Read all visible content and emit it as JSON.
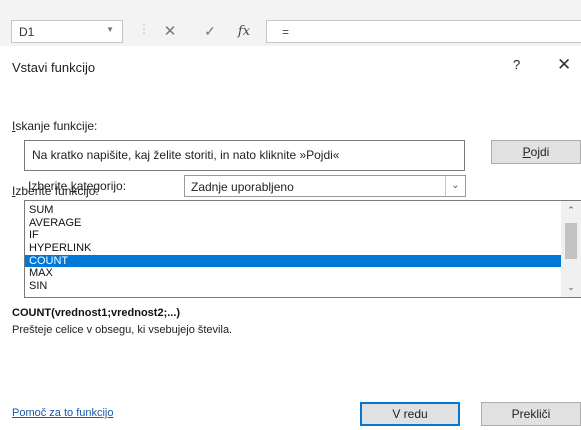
{
  "formula_bar": {
    "namebox": "D1",
    "namebox_arrow": "▼",
    "separator": "⋮",
    "cancel_icon": "✕",
    "enter_icon": "✓",
    "fx_icon": "fx",
    "formula": "="
  },
  "dialog": {
    "title": "Vstavi funkcijo",
    "help": "?",
    "close": "✕",
    "search_label_access": "I",
    "search_label_rest": "skanje funkcije:",
    "search_text": "Na kratko napišite, kaj želite storiti, in nato kliknite »Pojdi«",
    "go_access": "P",
    "go_rest": "ojdi",
    "category_label_pre": "Izberite ",
    "category_label_access": "k",
    "category_label_post": "ategorijo:",
    "category_value": "Zadnje uporabljeno",
    "function_label_access": "I",
    "function_label_rest": "zberite funkcijo:",
    "functions": [
      "SUM",
      "AVERAGE",
      "IF",
      "HYPERLINK",
      "COUNT",
      "MAX",
      "SIN"
    ],
    "selected_index": 4,
    "signature": "COUNT(vrednost1;vrednost2;...)",
    "description": "Prešteje celice v obsegu, ki vsebujejo števila.",
    "help_link": "Pomoč za to funkcijo",
    "ok_label": "V redu",
    "cancel_label": "Prekliči"
  },
  "colors": {
    "selection": "#0078d7",
    "link": "#1a5aa8"
  }
}
